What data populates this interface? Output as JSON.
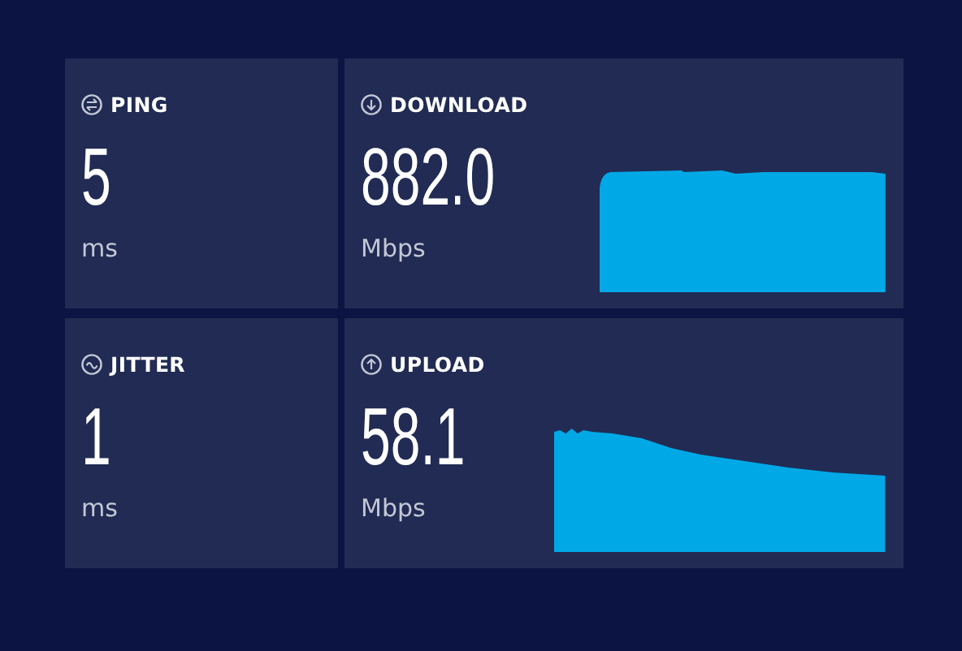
{
  "cards": [
    {
      "kind": "ping",
      "label": "PING",
      "value": "5",
      "unit": "ms"
    },
    {
      "kind": "download",
      "label": "DOWNLOAD",
      "value": "882.0",
      "unit": "Mbps"
    },
    {
      "kind": "jitter",
      "label": "JITTER",
      "value": "1",
      "unit": "ms"
    },
    {
      "kind": "upload",
      "label": "UPLOAD",
      "value": "58.1",
      "unit": "Mbps"
    }
  ]
}
